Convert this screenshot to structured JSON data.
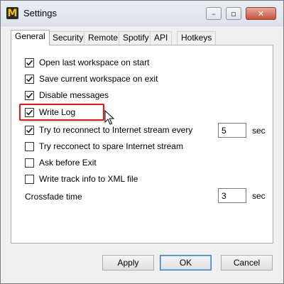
{
  "window": {
    "title": "Settings",
    "app_icon_letter": "M"
  },
  "tabs": [
    {
      "label": "General",
      "active": true
    },
    {
      "label": "Security",
      "active": false
    },
    {
      "label": "Remote",
      "active": false
    },
    {
      "label": "Spotify",
      "active": false
    },
    {
      "label": "API",
      "active": false
    },
    {
      "label": "Hotkeys",
      "active": false
    }
  ],
  "options": [
    {
      "label": "Open last workspace on start",
      "checked": true
    },
    {
      "label": "Save current workspace on exit",
      "checked": true
    },
    {
      "label": "Disable messages",
      "checked": true
    },
    {
      "label": "Write Log",
      "checked": true
    },
    {
      "label": "Try to reconnect to Internet stream every",
      "checked": true
    },
    {
      "label": "Try recconect to spare Internet stream",
      "checked": false
    },
    {
      "label": "Ask before Exit",
      "checked": false
    },
    {
      "label": "Write track info to XML file",
      "checked": false
    }
  ],
  "reconnect": {
    "value": "5",
    "unit": "sec"
  },
  "crossfade": {
    "label": "Crossfade time",
    "value": "3",
    "unit": "sec"
  },
  "buttons": {
    "apply": "Apply",
    "ok": "OK",
    "cancel": "Cancel"
  },
  "colors": {
    "highlight": "#e11a1a",
    "active_tab_bg": "#ffffff",
    "window_bg": "#f0f0f0"
  }
}
